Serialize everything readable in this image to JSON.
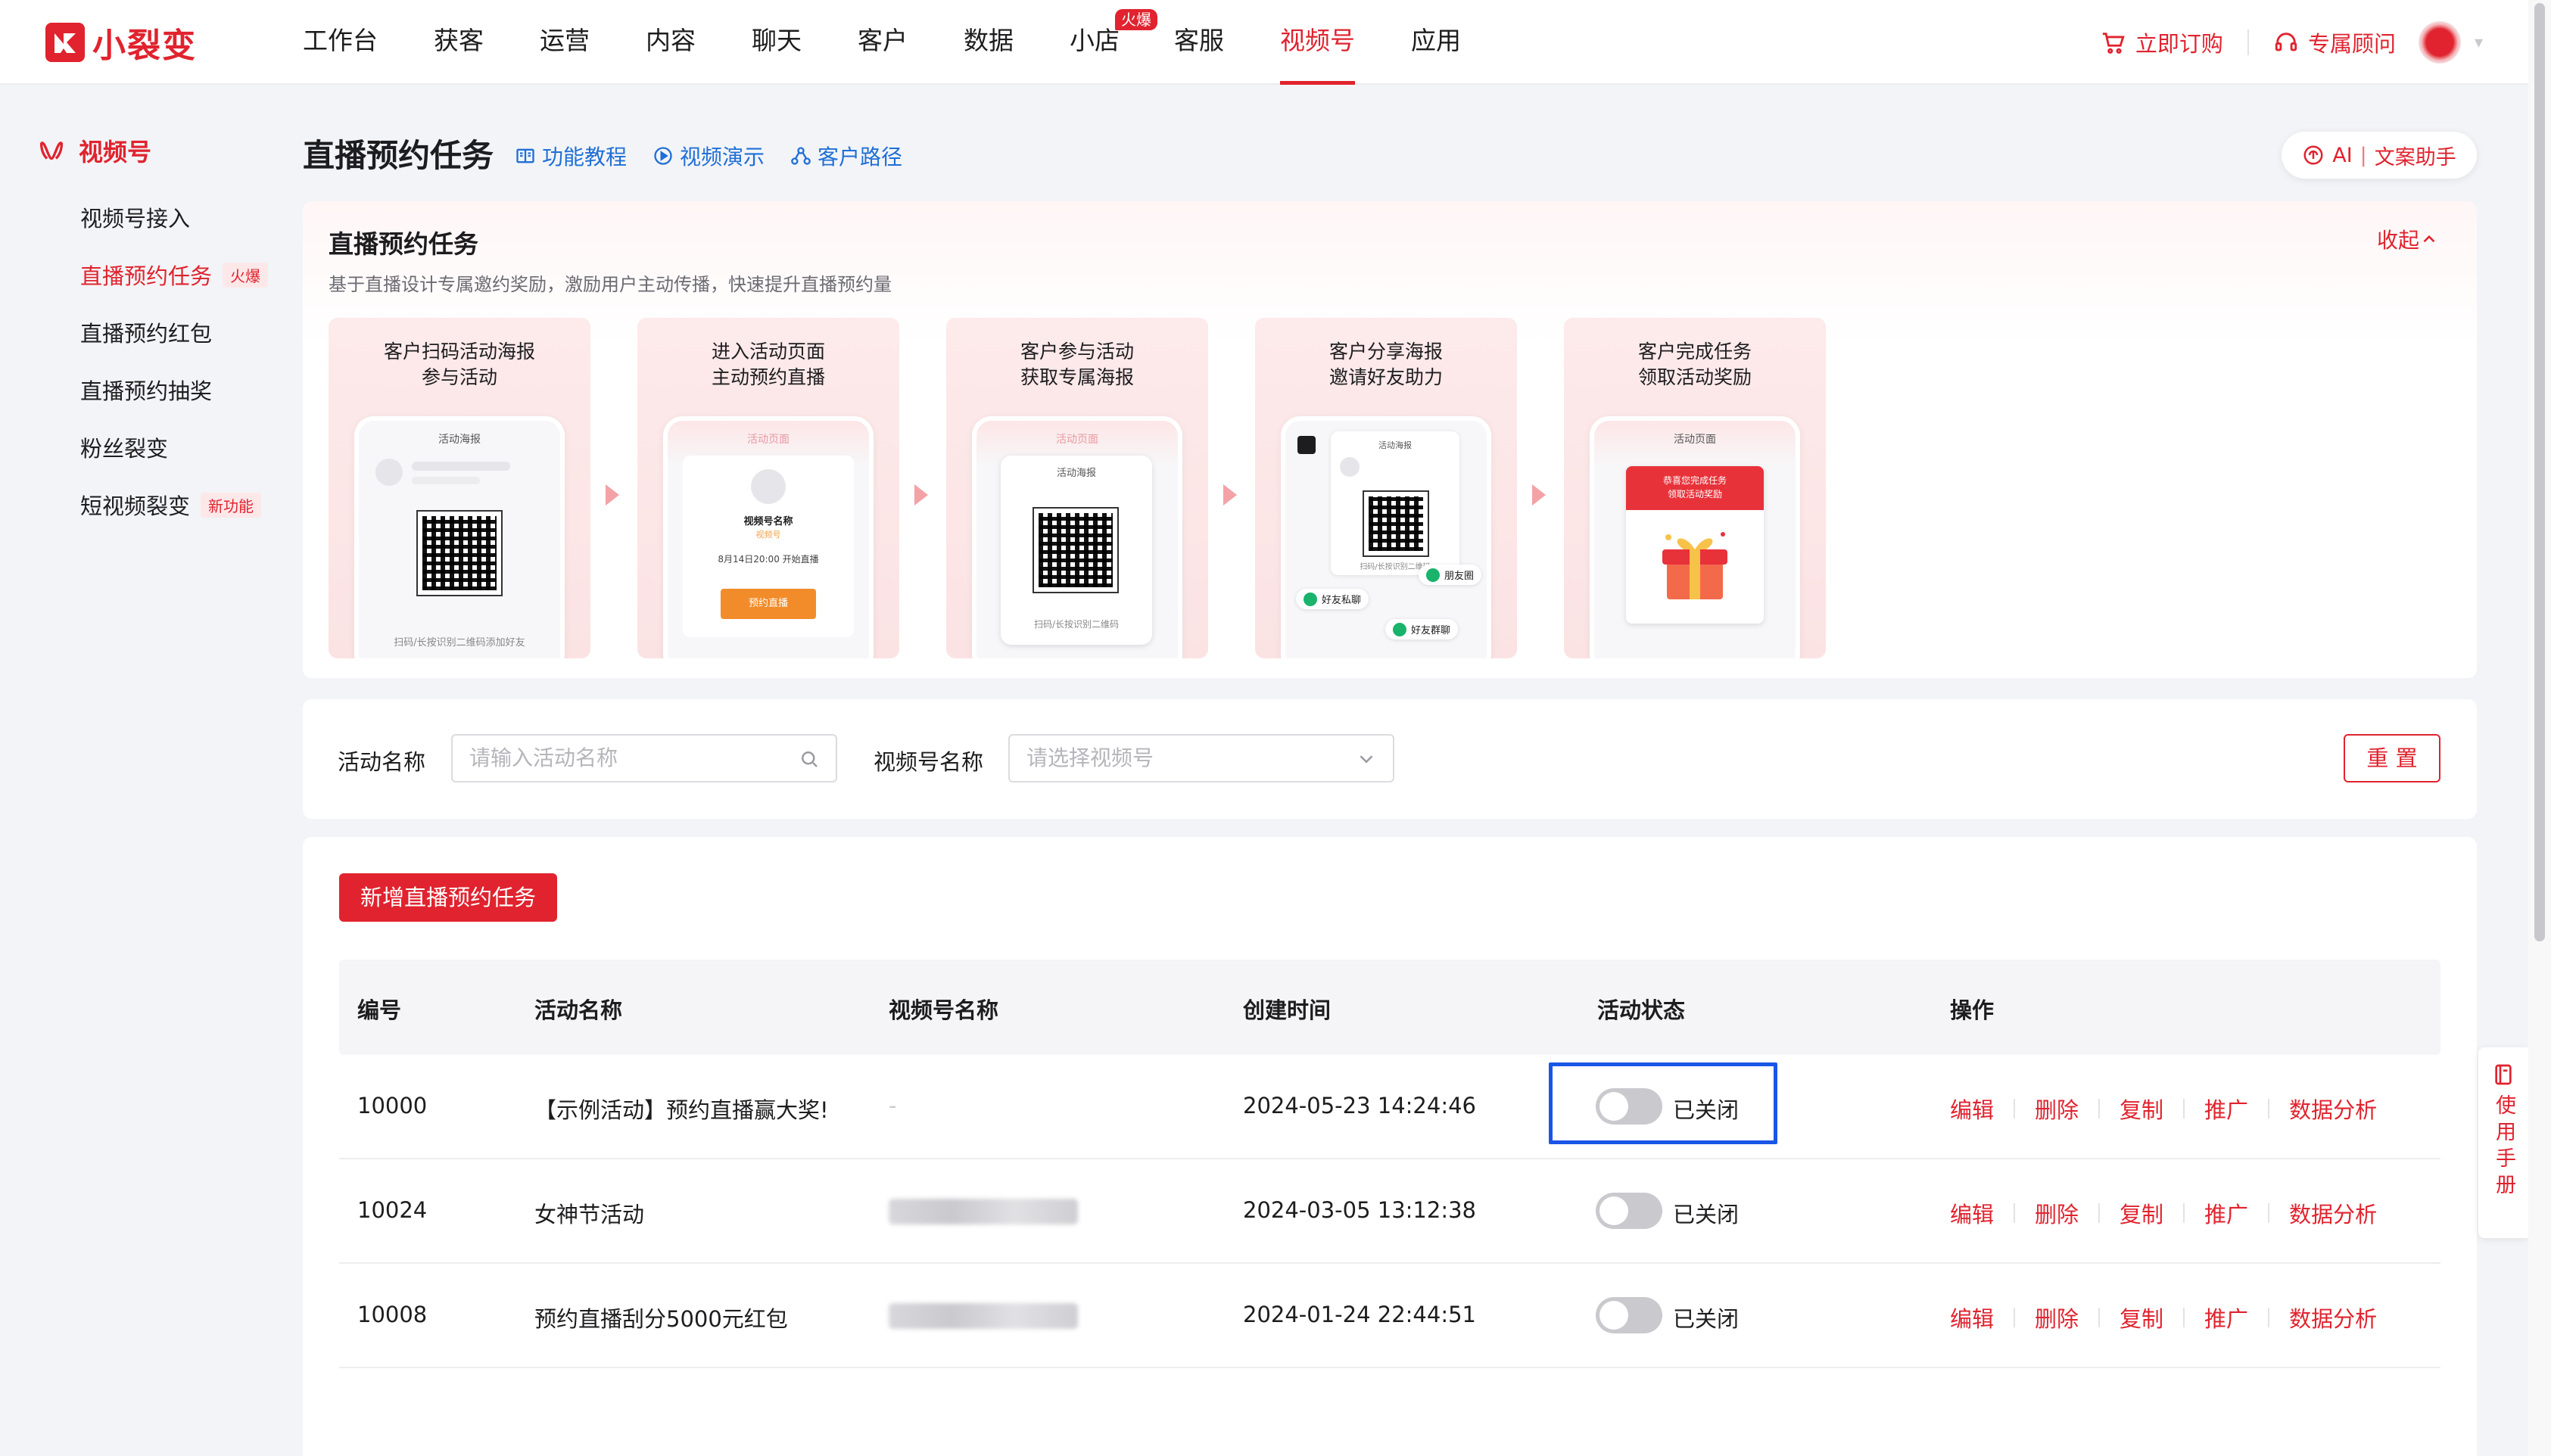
{
  "brand": {
    "name": "小裂变",
    "color": "#e0232e"
  },
  "nav": {
    "items": [
      "工作台",
      "获客",
      "运营",
      "内容",
      "聊天",
      "客户",
      "数据",
      "小店",
      "客服",
      "视频号",
      "应用"
    ],
    "active_index": 9,
    "shop_badge": "火爆"
  },
  "top_right": {
    "order": "立即订购",
    "advisor": "专属顾问"
  },
  "sidebar": {
    "title": "视频号",
    "items": [
      {
        "label": "视频号接入",
        "tag": ""
      },
      {
        "label": "直播预约任务",
        "tag": "火爆"
      },
      {
        "label": "直播预约红包",
        "tag": ""
      },
      {
        "label": "直播预约抽奖",
        "tag": ""
      },
      {
        "label": "粉丝裂变",
        "tag": ""
      },
      {
        "label": "短视频裂变",
        "tag": "新功能"
      }
    ],
    "active_index": 1
  },
  "header": {
    "title": "直播预约任务",
    "links": [
      "功能教程",
      "视频演示",
      "客户路径"
    ],
    "ai": {
      "left": "AI",
      "right": "文案助手"
    }
  },
  "intro": {
    "title": "直播预约任务",
    "desc": "基于直播设计专属邀约奖励，激励用户主动传播，快速提升直播预约量",
    "collapse": "收起",
    "steps": [
      {
        "line1": "客户扫码活动海报",
        "line2": "参与活动",
        "screen": "活动海报",
        "foot": "扫码/长按识别二维码添加好友"
      },
      {
        "line1": "进入活动页面",
        "line2": "主动预约直播",
        "screen": "活动页面",
        "name": "视频号名称",
        "sub": "视频号",
        "time": "8月14日20:00 开始直播",
        "btn": "预约直播"
      },
      {
        "line1": "客户参与活动",
        "line2": "获取专属海报",
        "screen": "活动页面",
        "poster": "活动海报",
        "foot": "扫码/长按识别二维码"
      },
      {
        "line1": "客户分享海报",
        "line2": "邀请好友助力",
        "screen": "活动海报",
        "foot": "扫码/长按识别二维码",
        "chips": [
          "朋友圈",
          "好友私聊",
          "好友群聊"
        ]
      },
      {
        "line1": "客户完成任务",
        "line2": "领取活动奖励",
        "screen": "活动页面",
        "reward1": "恭喜您完成任务",
        "reward2": "领取活动奖励"
      }
    ]
  },
  "filter": {
    "name_label": "活动名称",
    "name_placeholder": "请输入活动名称",
    "channel_label": "视频号名称",
    "channel_placeholder": "请选择视频号",
    "reset": "重 置"
  },
  "table": {
    "add_button": "新增直播预约任务",
    "columns": [
      "编号",
      "活动名称",
      "视频号名称",
      "创建时间",
      "活动状态",
      "操作"
    ],
    "rows": [
      {
        "id": "10000",
        "name": "【示例活动】预约直播赢大奖!",
        "channel": "-",
        "created": "2024-05-23 14:24:46",
        "status": "已关闭"
      },
      {
        "id": "10024",
        "name": "女神节活动",
        "channel": "",
        "created": "2024-03-05 13:12:38",
        "status": "已关闭"
      },
      {
        "id": "10008",
        "name": "预约直播刮分5000元红包",
        "channel": "",
        "created": "2024-01-24 22:44:51",
        "status": "已关闭"
      }
    ],
    "actions": [
      "编辑",
      "删除",
      "复制",
      "推广",
      "数据分析"
    ]
  },
  "manual": {
    "label": "使用手册"
  },
  "colors": {
    "accent": "#e0232e",
    "link": "#1f6fd6",
    "highlight": "#1a56e6"
  }
}
